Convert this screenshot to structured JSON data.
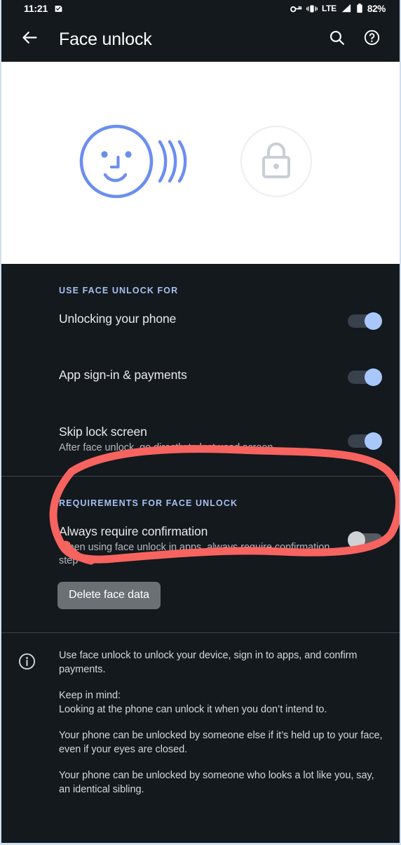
{
  "status_bar": {
    "time": "11:21",
    "notification_icon": "notification-badge-icon",
    "icons": [
      "key-icon",
      "vibrate-icon"
    ],
    "network": "LTE",
    "signal_icon": "signal-bars-icon",
    "battery_icon": "battery-icon",
    "battery": "82%"
  },
  "app_bar": {
    "back_icon": "arrow-back-icon",
    "title": "Face unlock",
    "search_icon": "search-icon",
    "help_icon": "help-circle-icon"
  },
  "hero": {
    "face_icon": "face-scan-icon",
    "waves_icon": "signal-waves-icon",
    "lock_icon": "lock-icon",
    "face_color": "#6b8ef0",
    "lock_color": "#c9ced6",
    "background": "#ffffff"
  },
  "sections": [
    {
      "header": "USE FACE UNLOCK FOR",
      "rows": [
        {
          "title": "Unlocking your phone",
          "subtitle": "",
          "toggle": "on"
        },
        {
          "title": "App sign-in & payments",
          "subtitle": "",
          "toggle": "on"
        },
        {
          "title": "Skip lock screen",
          "subtitle": "After face unlock, go directly to last used screen",
          "toggle": "on"
        }
      ]
    },
    {
      "header": "REQUIREMENTS FOR FACE UNLOCK",
      "rows": [
        {
          "title": "Always require confirmation",
          "subtitle": "When using face unlock in apps, always require confirmation step",
          "toggle": "off"
        }
      ],
      "chip_label": "Delete face data"
    }
  ],
  "footer": {
    "info_icon": "info-circle-icon",
    "paragraphs": [
      "Use face unlock to unlock your device, sign in to apps, and confirm payments.",
      "Keep in mind:\nLooking at the phone can unlock it when you don’t intend to.",
      "Your phone can be unlocked by someone else if it’s held up to your face, even if your eyes are closed.",
      "Your phone can be unlocked by someone who looks a lot like you, say, an identical sibling."
    ]
  },
  "annotation": {
    "shape": "hand-drawn-red-ellipse",
    "color": "#f7635f",
    "target": "Always require confirmation"
  },
  "theme": {
    "background": "#14191e",
    "surface": "#14191e",
    "accent": "#a6c1ee",
    "toggle_on": "#a8c7fa",
    "toggle_off": "#cfd2d4",
    "divider": "#3a4249",
    "text_primary": "#e9eaec",
    "text_secondary": "#b3b8bd"
  }
}
